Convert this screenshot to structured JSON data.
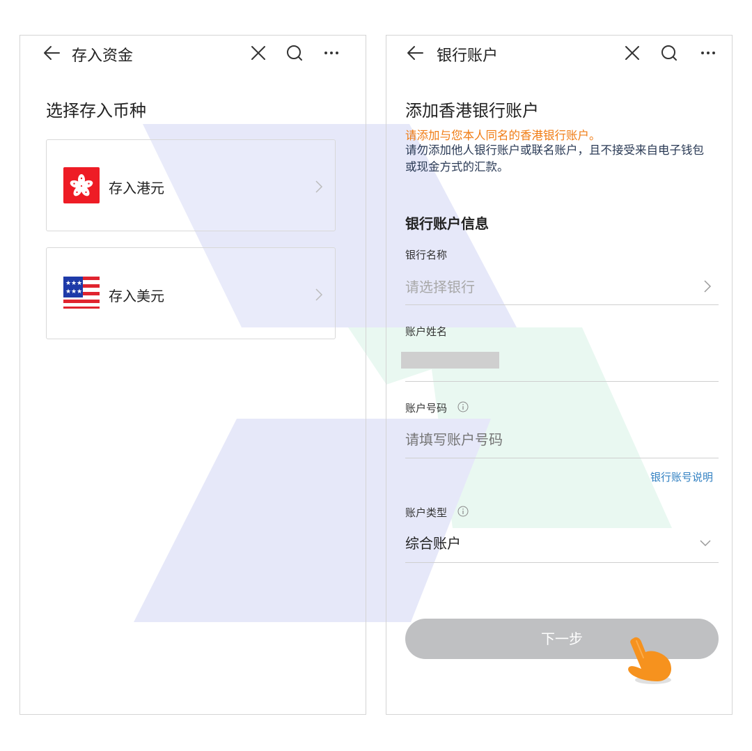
{
  "left_screen": {
    "title": "存入资金",
    "heading": "选择存入币种",
    "options": [
      {
        "label": "存入港元",
        "icon": "hong-kong-flag-icon"
      },
      {
        "label": "存入美元",
        "icon": "us-flag-icon"
      }
    ]
  },
  "right_screen": {
    "title": "银行账户",
    "heading": "添加香港银行账户",
    "notice_orange": "请添加与您本人同名的香港银行账户。",
    "notice": "请勿添加他人银行账户或联名账户，且不接受来自电子钱包或现金方式的汇款。",
    "section_title": "银行账户信息",
    "fields": {
      "bank_name": {
        "label": "银行名称",
        "placeholder": "请选择银行"
      },
      "account_name": {
        "label": "账户姓名"
      },
      "account_number": {
        "label": "账户号码",
        "placeholder": "请填写账户号码"
      },
      "account_type": {
        "label": "账户类型",
        "value": "综合账户"
      }
    },
    "help_link": "银行账号说明",
    "next_button": "下一步"
  },
  "colors": {
    "accent_orange": "#f07c14",
    "link_blue": "#2f7fc1",
    "button_disabled": "#bfc0c2"
  }
}
